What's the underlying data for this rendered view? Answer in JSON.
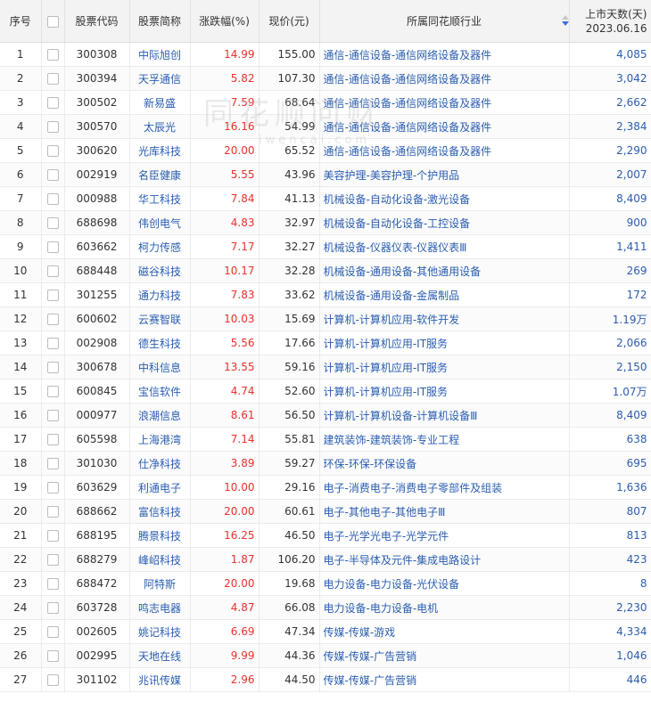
{
  "header": {
    "index": "序号",
    "code": "股票代码",
    "name": "股票简称",
    "change": "涨跌幅(%)",
    "price": "现价(元)",
    "industry": "所属同花顺行业",
    "listed_days": "上市天数(天)",
    "listed_date": "2023.06.16"
  },
  "watermark": {
    "brand": "同花顺问财",
    "url": "iwencai.com"
  },
  "colors": {
    "link": "#2a5db0",
    "up": "#e5322d",
    "header_bg": "#f3f3f3",
    "sort_active": "#3b6fd8"
  },
  "rows": [
    {
      "idx": "1",
      "code": "300308",
      "name": "中际旭创",
      "change": "14.99",
      "price": "155.00",
      "industry": "通信-通信设备-通信网络设备及器件",
      "days": "4,085"
    },
    {
      "idx": "2",
      "code": "300394",
      "name": "天孚通信",
      "change": "5.82",
      "price": "107.30",
      "industry": "通信-通信设备-通信网络设备及器件",
      "days": "3,042"
    },
    {
      "idx": "3",
      "code": "300502",
      "name": "新易盛",
      "change": "7.59",
      "price": "68.64",
      "industry": "通信-通信设备-通信网络设备及器件",
      "days": "2,662"
    },
    {
      "idx": "4",
      "code": "300570",
      "name": "太辰光",
      "change": "16.16",
      "price": "54.99",
      "industry": "通信-通信设备-通信网络设备及器件",
      "days": "2,384"
    },
    {
      "idx": "5",
      "code": "300620",
      "name": "光库科技",
      "change": "20.00",
      "price": "65.52",
      "industry": "通信-通信设备-通信网络设备及器件",
      "days": "2,290"
    },
    {
      "idx": "6",
      "code": "002919",
      "name": "名臣健康",
      "change": "5.55",
      "price": "43.96",
      "industry": "美容护理-美容护理-个护用品",
      "days": "2,007"
    },
    {
      "idx": "7",
      "code": "000988",
      "name": "华工科技",
      "change": "7.84",
      "price": "41.13",
      "industry": "机械设备-自动化设备-激光设备",
      "days": "8,409"
    },
    {
      "idx": "8",
      "code": "688698",
      "name": "伟创电气",
      "change": "4.83",
      "price": "32.97",
      "industry": "机械设备-自动化设备-工控设备",
      "days": "900"
    },
    {
      "idx": "9",
      "code": "603662",
      "name": "柯力传感",
      "change": "7.17",
      "price": "32.27",
      "industry": "机械设备-仪器仪表-仪器仪表Ⅲ",
      "days": "1,411"
    },
    {
      "idx": "10",
      "code": "688448",
      "name": "磁谷科技",
      "change": "10.17",
      "price": "32.28",
      "industry": "机械设备-通用设备-其他通用设备",
      "days": "269"
    },
    {
      "idx": "11",
      "code": "301255",
      "name": "通力科技",
      "change": "7.83",
      "price": "33.62",
      "industry": "机械设备-通用设备-金属制品",
      "days": "172"
    },
    {
      "idx": "12",
      "code": "600602",
      "name": "云赛智联",
      "change": "10.03",
      "price": "15.69",
      "industry": "计算机-计算机应用-软件开发",
      "days": "1.19万"
    },
    {
      "idx": "13",
      "code": "002908",
      "name": "德生科技",
      "change": "5.56",
      "price": "17.66",
      "industry": "计算机-计算机应用-IT服务",
      "days": "2,066"
    },
    {
      "idx": "14",
      "code": "300678",
      "name": "中科信息",
      "change": "13.55",
      "price": "59.16",
      "industry": "计算机-计算机应用-IT服务",
      "days": "2,150"
    },
    {
      "idx": "15",
      "code": "600845",
      "name": "宝信软件",
      "change": "4.74",
      "price": "52.60",
      "industry": "计算机-计算机应用-IT服务",
      "days": "1.07万"
    },
    {
      "idx": "16",
      "code": "000977",
      "name": "浪潮信息",
      "change": "8.61",
      "price": "56.50",
      "industry": "计算机-计算机设备-计算机设备Ⅲ",
      "days": "8,409"
    },
    {
      "idx": "17",
      "code": "605598",
      "name": "上海港湾",
      "change": "7.14",
      "price": "55.81",
      "industry": "建筑装饰-建筑装饰-专业工程",
      "days": "638"
    },
    {
      "idx": "18",
      "code": "301030",
      "name": "仕净科技",
      "change": "3.89",
      "price": "59.27",
      "industry": "环保-环保-环保设备",
      "days": "695"
    },
    {
      "idx": "19",
      "code": "603629",
      "name": "利通电子",
      "change": "10.00",
      "price": "29.16",
      "industry": "电子-消费电子-消费电子零部件及组装",
      "days": "1,636"
    },
    {
      "idx": "20",
      "code": "688662",
      "name": "富信科技",
      "change": "20.00",
      "price": "60.61",
      "industry": "电子-其他电子-其他电子Ⅲ",
      "days": "807"
    },
    {
      "idx": "21",
      "code": "688195",
      "name": "腾景科技",
      "change": "16.25",
      "price": "46.50",
      "industry": "电子-光学光电子-光学元件",
      "days": "813"
    },
    {
      "idx": "22",
      "code": "688279",
      "name": "峰岹科技",
      "change": "1.87",
      "price": "106.20",
      "industry": "电子-半导体及元件-集成电路设计",
      "days": "423"
    },
    {
      "idx": "23",
      "code": "688472",
      "name": "阿特斯",
      "change": "20.00",
      "price": "19.68",
      "industry": "电力设备-电力设备-光伏设备",
      "days": "8"
    },
    {
      "idx": "24",
      "code": "603728",
      "name": "鸣志电器",
      "change": "4.87",
      "price": "66.08",
      "industry": "电力设备-电力设备-电机",
      "days": "2,230"
    },
    {
      "idx": "25",
      "code": "002605",
      "name": "姚记科技",
      "change": "6.69",
      "price": "47.34",
      "industry": "传媒-传媒-游戏",
      "days": "4,334"
    },
    {
      "idx": "26",
      "code": "002995",
      "name": "天地在线",
      "change": "9.99",
      "price": "44.36",
      "industry": "传媒-传媒-广告营销",
      "days": "1,046"
    },
    {
      "idx": "27",
      "code": "301102",
      "name": "兆讯传媒",
      "change": "2.96",
      "price": "44.50",
      "industry": "传媒-传媒-广告营销",
      "days": "446"
    }
  ]
}
